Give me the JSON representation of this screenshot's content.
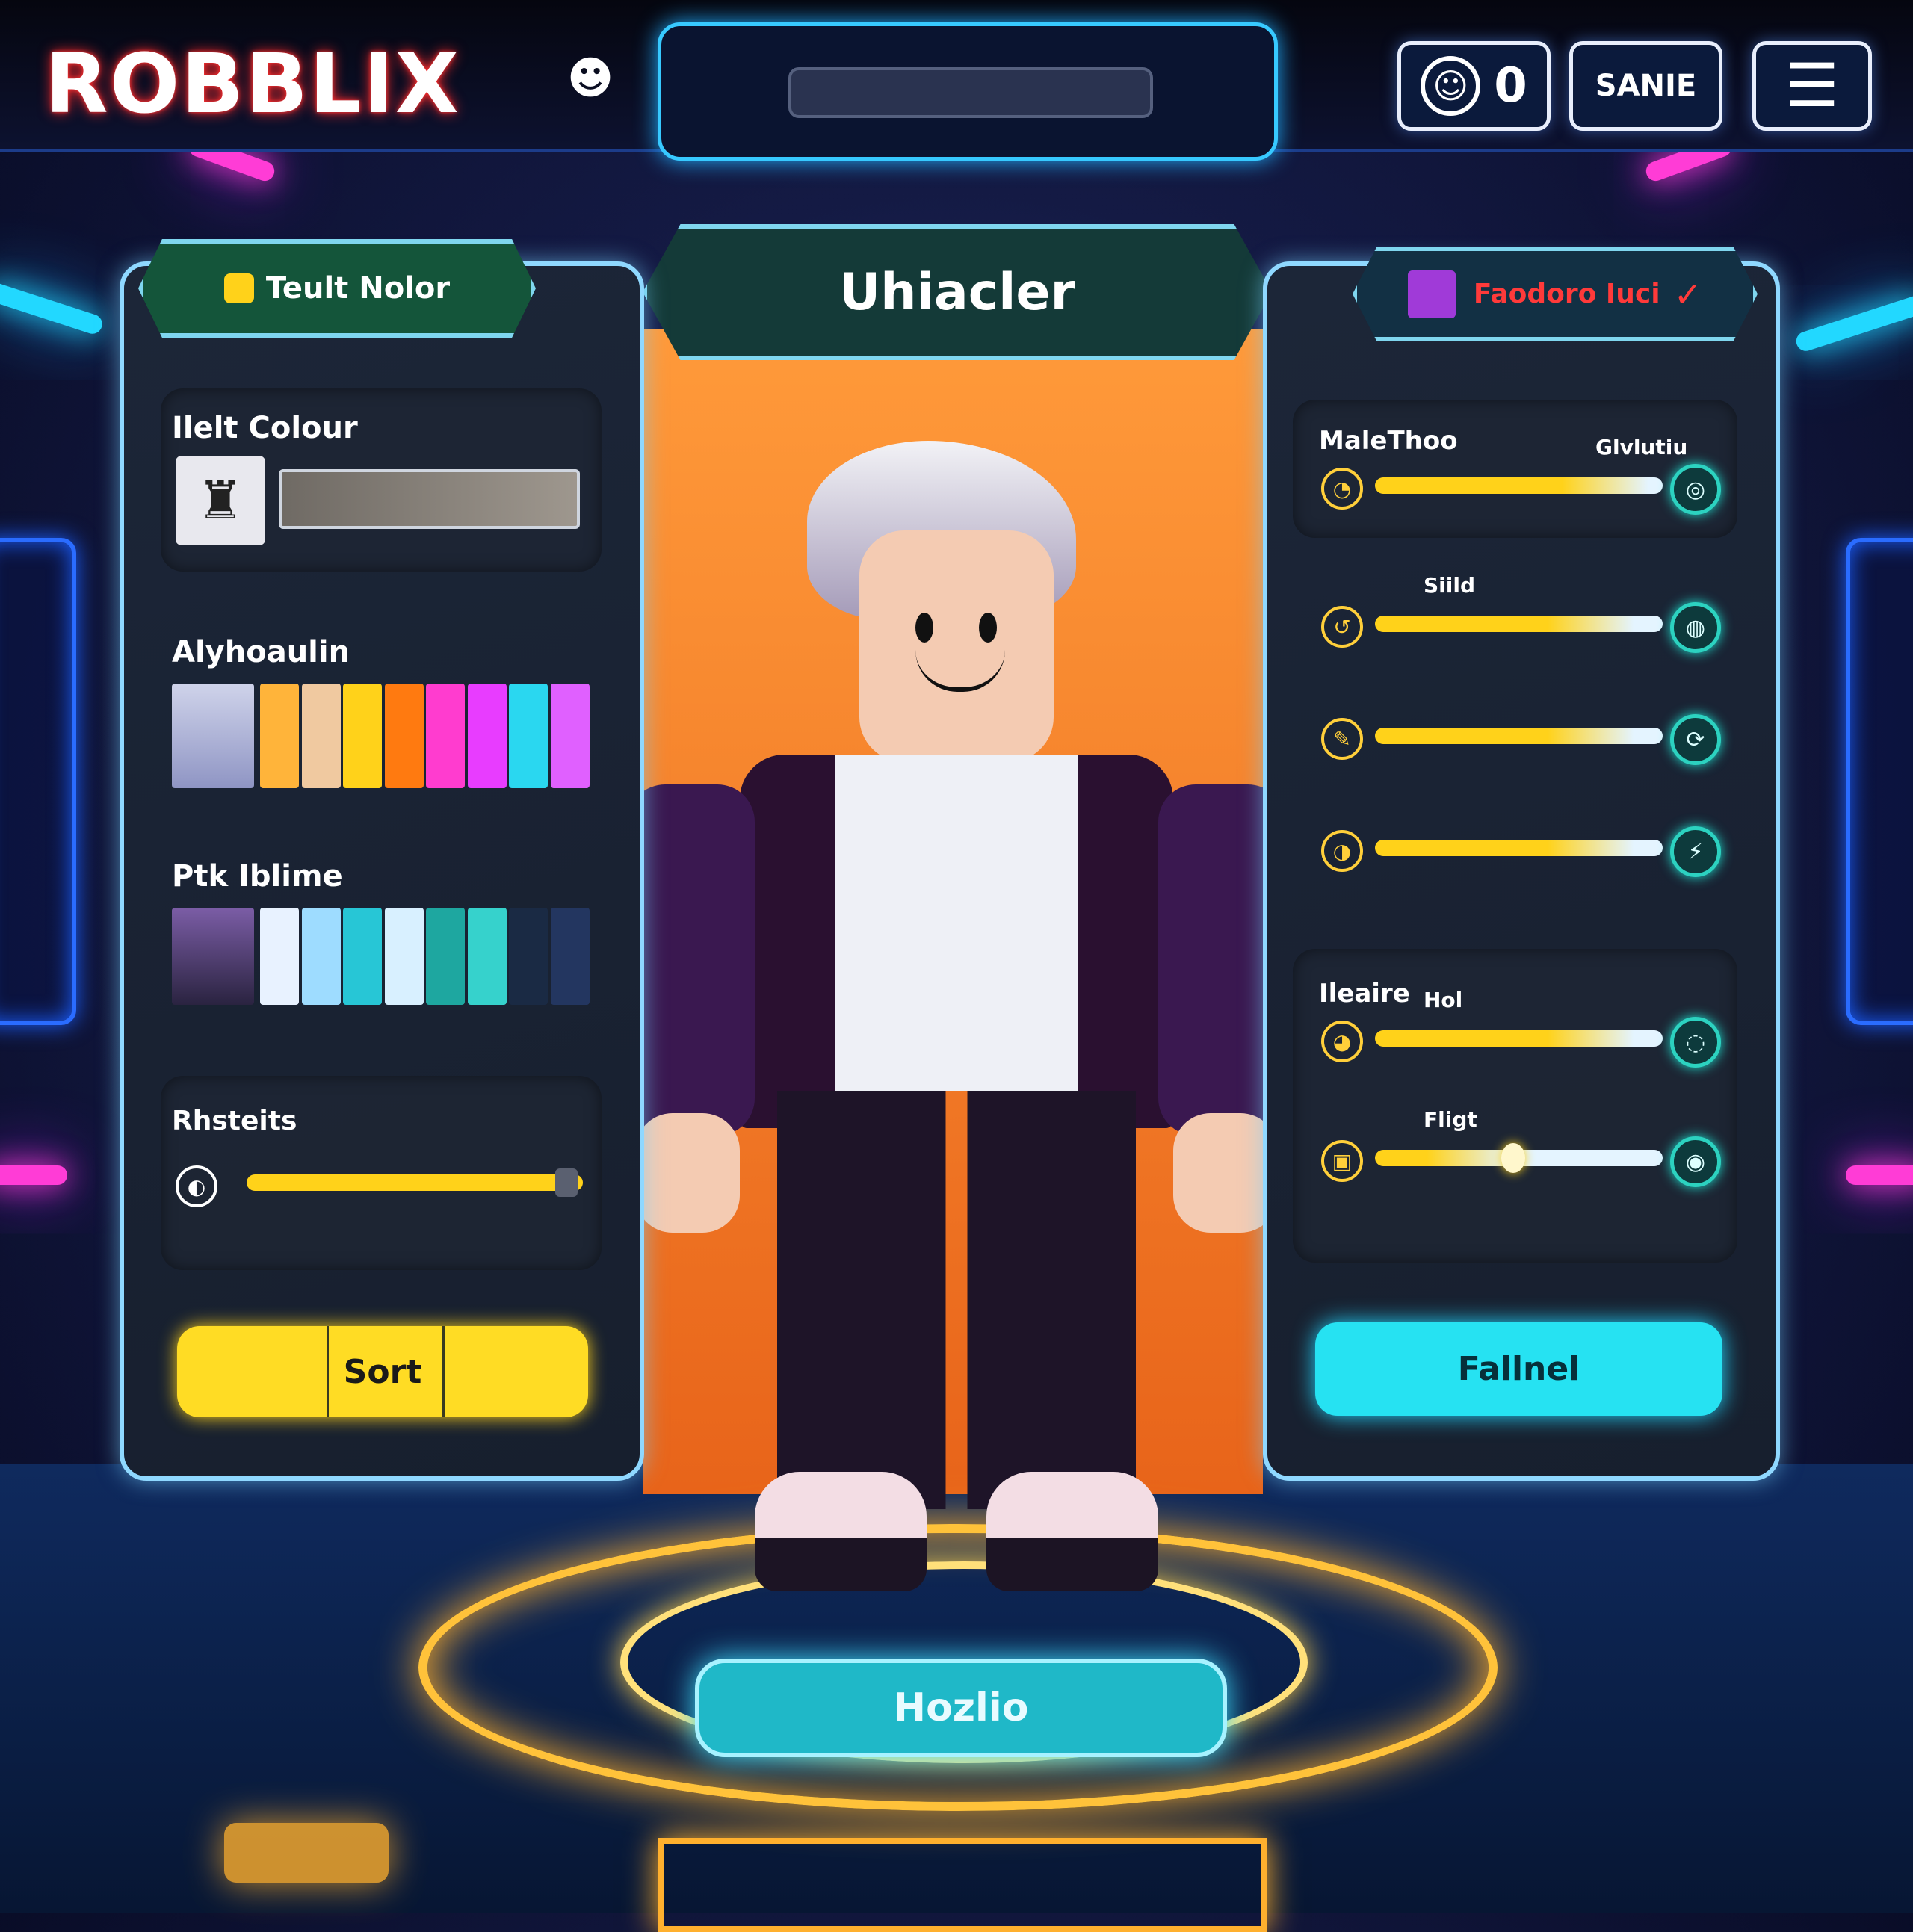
{
  "app": {
    "logo": "ROBBLIX"
  },
  "topbar": {
    "coins_value": "0",
    "save_label": "SANIE"
  },
  "center": {
    "title": "Uhiacler",
    "platform_label": "Hozlio"
  },
  "left_panel": {
    "tab_label": "Teult Nolor",
    "hair_color_label": "Ilelt Colour",
    "swatch_row1_label": "Alyhoaulin",
    "swatch_row1_colors": [
      "#ffb43a",
      "#f0c9a0",
      "#ffd21a",
      "#ff7a10",
      "#ff3ccf",
      "#e83cff",
      "#2ad7f0",
      "#e060ff"
    ],
    "swatch_row2_label": "Ptk Iblime",
    "swatch_row2_colors": [
      "#e8f2ff",
      "#9edcff",
      "#27c6d6",
      "#d8f0ff",
      "#1ea7a0",
      "#36d2cc",
      "#1a2a44",
      "#233660"
    ],
    "slider_label": "Rhsteits",
    "slider_value": 0.95,
    "button_label": "Sort"
  },
  "right_panel": {
    "tab_label": "Faodoro Iuci",
    "sliders": [
      {
        "label": "MaleThoo",
        "sublabel": "Glvlutiu",
        "value": 0.95
      },
      {
        "label": "",
        "sublabel": "Siild",
        "value": 0.9
      },
      {
        "label": "",
        "sublabel": "",
        "value": 0.9
      },
      {
        "label": "",
        "sublabel": "",
        "value": 0.9
      },
      {
        "label": "Ileaire",
        "sublabel": "Hol",
        "value": 0.9
      },
      {
        "label": "",
        "sublabel": "Fligt",
        "value": 0.48
      }
    ],
    "button_label": "Fallnel"
  },
  "colors": {
    "accent_cyan": "#22d8ff",
    "accent_yellow": "#ffd21a",
    "accent_magenta": "#ff3cd6"
  }
}
